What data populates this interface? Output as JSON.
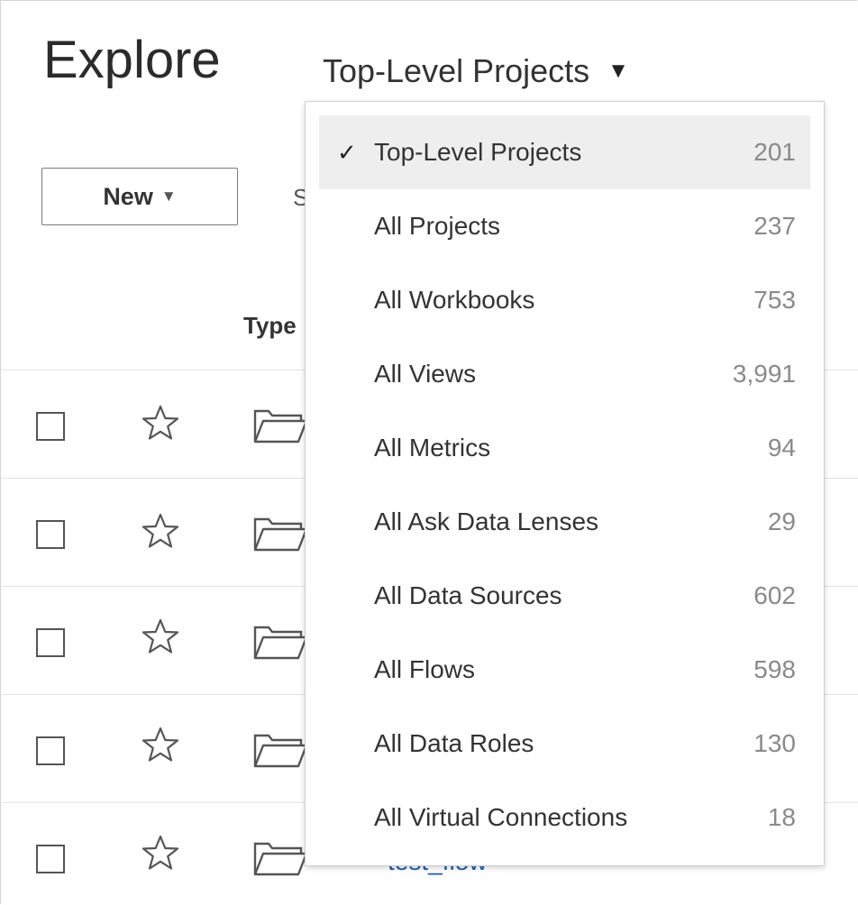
{
  "header": {
    "title": "Explore",
    "selector_label": "Top-Level Projects",
    "selector_caret": "▼"
  },
  "toolbar": {
    "new_label": "New",
    "new_caret": "▼",
    "sort_fragment": "S"
  },
  "table": {
    "type_header": "Type",
    "link_fragment": "test_flow"
  },
  "dropdown": {
    "selected_check": "✓",
    "items": [
      {
        "label": "Top-Level Projects",
        "count": "201",
        "selected": true
      },
      {
        "label": "All Projects",
        "count": "237"
      },
      {
        "label": "All Workbooks",
        "count": "753"
      },
      {
        "label": "All Views",
        "count": "3,991"
      },
      {
        "label": "All Metrics",
        "count": "94"
      },
      {
        "label": "All Ask Data Lenses",
        "count": "29"
      },
      {
        "label": "All Data Sources",
        "count": "602"
      },
      {
        "label": "All Flows",
        "count": "598"
      },
      {
        "label": "All Data Roles",
        "count": "130"
      },
      {
        "label": "All Virtual Connections",
        "count": "18"
      }
    ]
  },
  "icons": {
    "row_star": "star-outline-icon",
    "row_type": "folder-open-icon"
  }
}
